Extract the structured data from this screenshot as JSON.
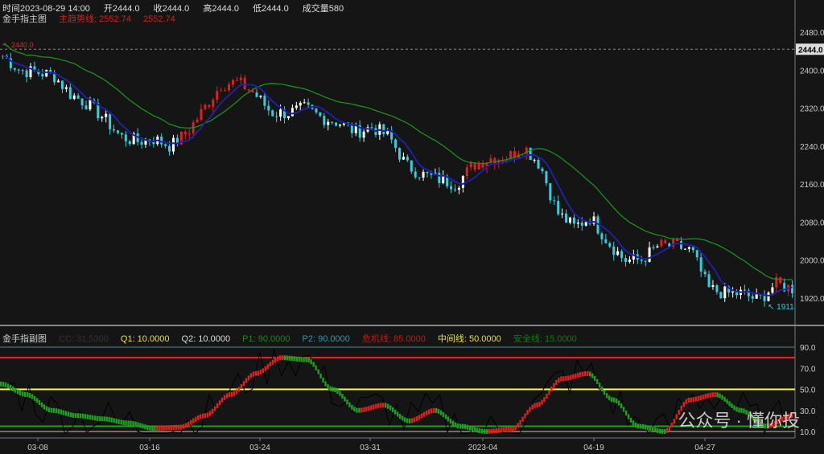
{
  "header": {
    "time": "时间2023-08-29 14:00",
    "open": "开2444.0",
    "close": "收2444.0",
    "high": "高2444.0",
    "low": "低2444.0",
    "volume": "成交量580"
  },
  "main_panel": {
    "title": "金手指主图",
    "trend_label": "主趋势线: 2552.74",
    "trend_value2": "2552.74",
    "high_marker": "2440.0",
    "low_marker": "1911.",
    "current_price": "2444.0"
  },
  "sub_panel": {
    "title": "金手指副图",
    "cc": "CC: 31.5300",
    "q1": "Q1: 10.0000",
    "q2": "Q2: 10.0000",
    "p1": "P1: 90.0000",
    "p2": "P2: 90.0000",
    "danger": "危机线: 85.0000",
    "middle": "中间线: 50.0000",
    "safe": "安全线: 15.0000"
  },
  "watermark": "公众号 · 懂你投",
  "colors": {
    "up": "#e02020",
    "down": "#30d0e0",
    "ma_long": "#1a9a1a",
    "ma_short": "#2020a0",
    "danger": "#ff2020",
    "middle": "#ffff30",
    "safe": "#20a020",
    "p_line": "#2a6a6a",
    "osc_up": "#e02020",
    "osc_down": "#20a020"
  },
  "chart_data": [
    {
      "type": "candlestick",
      "x_ticks": [
        "03-08",
        "03-16",
        "03-24",
        "03-31",
        "2023-04",
        "04-19",
        "04-27"
      ],
      "y_ticks": [
        2480,
        2400,
        2320,
        2240,
        2160,
        2080,
        2000,
        1920
      ],
      "ylim": [
        1870,
        2510
      ],
      "close": [
        2430,
        2400,
        2395,
        2390,
        2350,
        2330,
        2300,
        2260,
        2250,
        2255,
        2240,
        2270,
        2320,
        2370,
        2375,
        2350,
        2310,
        2310,
        2320,
        2300,
        2290,
        2270,
        2280,
        2260,
        2200,
        2180,
        2170,
        2160,
        2200,
        2215,
        2215,
        2240,
        2200,
        2100,
        2070,
        2090,
        2040,
        2000,
        2000,
        2030,
        2030,
        2020,
        1940,
        1930,
        1930,
        1915,
        1950,
        1940
      ]
    },
    {
      "type": "line",
      "y_ticks": [
        90,
        70,
        50,
        30,
        10
      ],
      "ylim": [
        5,
        97
      ],
      "levels": {
        "danger": 80,
        "middle": 50,
        "safe": 15,
        "p": 90,
        "bottom": 10
      },
      "oscillator": [
        55,
        45,
        30,
        25,
        22,
        18,
        13,
        14,
        25,
        45,
        65,
        80,
        78,
        50,
        30,
        35,
        20,
        30,
        15,
        10,
        12,
        35,
        60,
        65,
        40,
        15,
        10,
        40,
        45,
        30,
        15,
        25
      ]
    }
  ]
}
